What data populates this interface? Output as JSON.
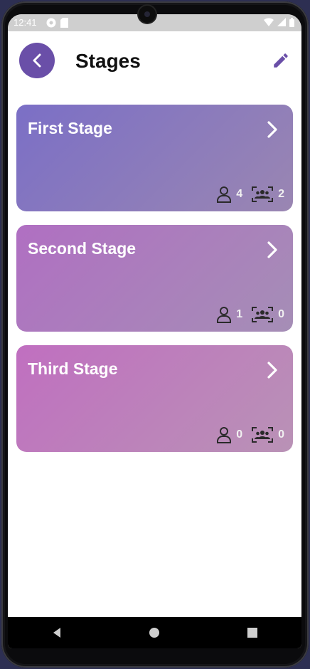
{
  "status_bar": {
    "time": "12:41",
    "left_icons": [
      "media-icon",
      "sd-card-icon"
    ],
    "right_icons": [
      "wifi-icon",
      "signal-icon",
      "battery-icon"
    ]
  },
  "header": {
    "title": "Stages",
    "back_icon": "chevron-left-icon",
    "edit_icon": "pencil-icon"
  },
  "stages": [
    {
      "name": "First Stage",
      "students": "4",
      "groups": "2"
    },
    {
      "name": "Second Stage",
      "students": "1",
      "groups": "0"
    },
    {
      "name": "Third Stage",
      "students": "0",
      "groups": "0"
    }
  ],
  "colors": {
    "accent": "#6a4fa8",
    "card1_from": "#7b6fc6",
    "card1_to": "#9a86b2",
    "card2_from": "#b06fc2",
    "card2_to": "#a58eb6",
    "card3_from": "#c06fc0",
    "card3_to": "#b992b6"
  },
  "nav_bar": [
    "back-triangle-icon",
    "home-circle-icon",
    "recents-square-icon"
  ]
}
